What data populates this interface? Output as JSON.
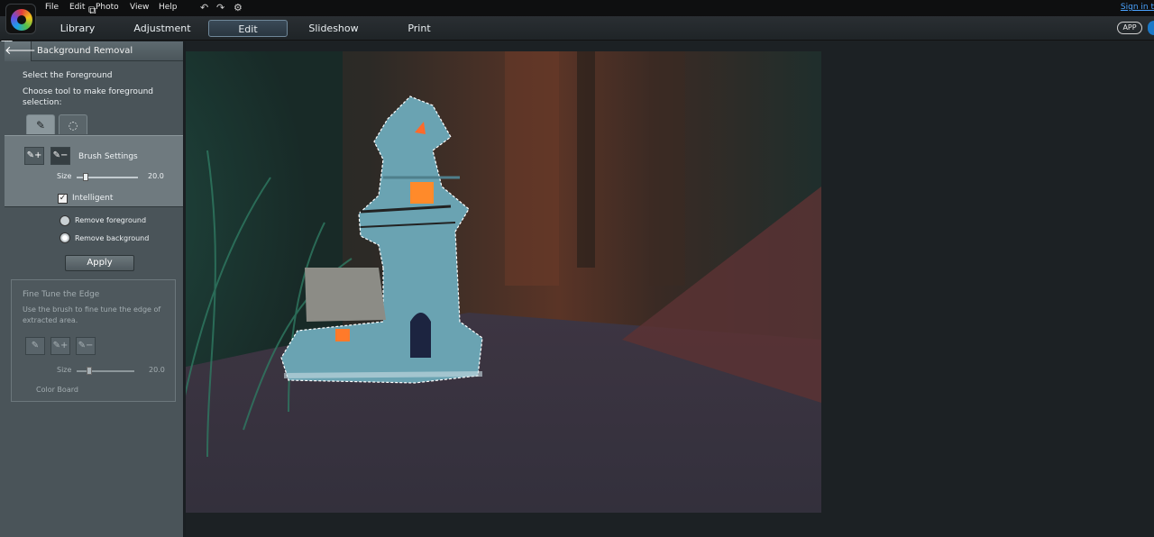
{
  "menubar": {
    "items": [
      "File",
      "Edit",
      "Photo",
      "View",
      "Help"
    ],
    "signin": "Sign in t"
  },
  "tabs": {
    "items": [
      "Library",
      "Adjustment",
      "Edit",
      "Slideshow",
      "Print"
    ],
    "active": "Edit",
    "app_badge": "APP"
  },
  "panel": {
    "title": "Background Removal",
    "select_heading": "Select the Foreground",
    "choose_line1": "Choose tool to make foreground",
    "choose_line2": "selection:",
    "brush_settings": "Brush Settings",
    "size_label": "Size",
    "size_value": "20.0",
    "size_level": 0.15,
    "intelligent_label": "Intelligent",
    "intelligent_checked": true,
    "remove_foreground": "Remove foreground",
    "remove_background": "Remove background",
    "selected_mode": "Remove background",
    "apply": "Apply",
    "fine": {
      "title": "Fine Tune the Edge",
      "desc_line1": "Use the brush to fine tune the edge of",
      "desc_line2": "extracted area.",
      "size_label": "Size",
      "size_value": "20.0",
      "color_board": "Color Board"
    }
  },
  "icons": {
    "back": "arrow-left-icon",
    "undo": "undo-icon",
    "redo": "redo-icon",
    "settings": "gear-icon",
    "brush": "brush-icon",
    "lasso": "lasso-icon"
  },
  "colors": {
    "accent": "#1a78c8",
    "link": "#4aa3ff",
    "panel": "#4a5459",
    "workspace": "#56636b"
  }
}
